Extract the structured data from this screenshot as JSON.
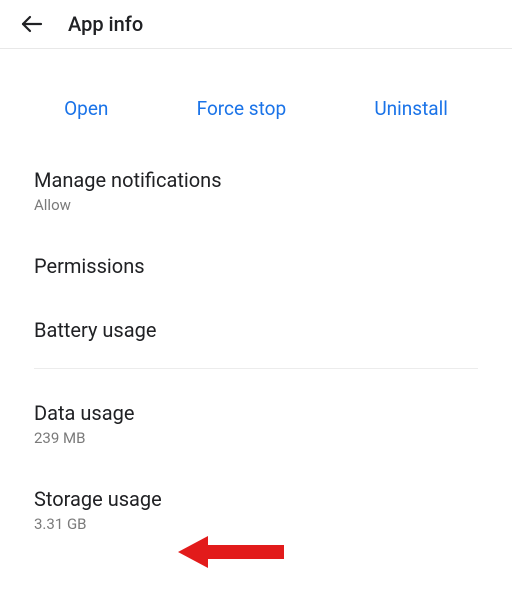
{
  "header": {
    "title": "App info"
  },
  "actions": {
    "open": "Open",
    "force_stop": "Force stop",
    "uninstall": "Uninstall"
  },
  "items": {
    "notifications": {
      "title": "Manage notifications",
      "sub": "Allow"
    },
    "permissions": {
      "title": "Permissions"
    },
    "battery": {
      "title": "Battery usage"
    },
    "data": {
      "title": "Data usage",
      "sub": "239 MB"
    },
    "storage": {
      "title": "Storage usage",
      "sub": "3.31 GB"
    }
  },
  "annotation": {
    "arrow_color": "#e21b1b"
  }
}
